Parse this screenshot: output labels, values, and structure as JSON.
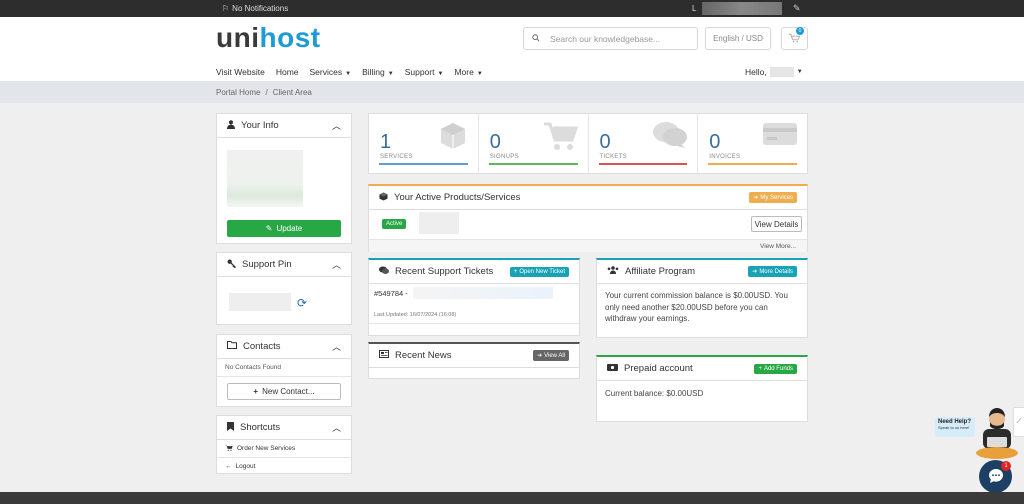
{
  "topbar": {
    "notifications": "No Notifications",
    "account_initial": "L"
  },
  "brand": {
    "part1": "uni",
    "part2": "host"
  },
  "search": {
    "placeholder": "Search our knowledgebase..."
  },
  "currency": "English / USD",
  "cart": {
    "count": "0"
  },
  "nav": {
    "items": [
      {
        "label": "Visit Website"
      },
      {
        "label": "Home"
      },
      {
        "label": "Services"
      },
      {
        "label": "Billing"
      },
      {
        "label": "Support"
      },
      {
        "label": "More"
      }
    ],
    "hello": "Hello,"
  },
  "breadcrumb": {
    "home": "Portal Home",
    "sep": "/",
    "current": "Client Area"
  },
  "your_info": {
    "title": "Your Info",
    "update": "Update"
  },
  "support_pin": {
    "title": "Support Pin"
  },
  "contacts": {
    "title": "Contacts",
    "empty": "No Contacts Found",
    "new": "New Contact..."
  },
  "shortcuts": {
    "title": "Shortcuts",
    "items": [
      {
        "label": "Order New Services"
      },
      {
        "label": "Logout"
      }
    ]
  },
  "stats": [
    {
      "value": "1",
      "label": "SERVICES",
      "color": "#5aa0d6"
    },
    {
      "value": "0",
      "label": "SIGNUPS",
      "color": "#5cb85c"
    },
    {
      "value": "0",
      "label": "TICKETS",
      "color": "#d9534f"
    },
    {
      "value": "0",
      "label": "INVOICES",
      "color": "#f0ad4e"
    }
  ],
  "products": {
    "title": "Your Active Products/Services",
    "my_services": "My Services",
    "status": "Active",
    "view_details": "View Details",
    "view_more": "View More..."
  },
  "tickets": {
    "title": "Recent Support Tickets",
    "open_new": "Open New Ticket",
    "ticket_id": "#549784 -",
    "updated": "Last Updated: 16/07/2024 (16:08)"
  },
  "news": {
    "title": "Recent News",
    "view_all": "View All"
  },
  "affiliate": {
    "title": "Affiliate Program",
    "more": "More Details",
    "text": "Your current commission balance is $0.00USD. You only need another $20.00USD before you can withdraw your earnings."
  },
  "prepaid": {
    "title": "Prepaid account",
    "add_funds": "Add Funds",
    "balance": "Current balance: $0.00USD"
  },
  "chat": {
    "bubble1": "Need Help?",
    "bubble2": "Speak to us here!",
    "unread": "1"
  },
  "colors": {
    "accent": "#1e9bd7",
    "green": "#28a745",
    "orange": "#f0ad4e",
    "teal": "#17a2b8",
    "dark": "#2d2d2d"
  }
}
